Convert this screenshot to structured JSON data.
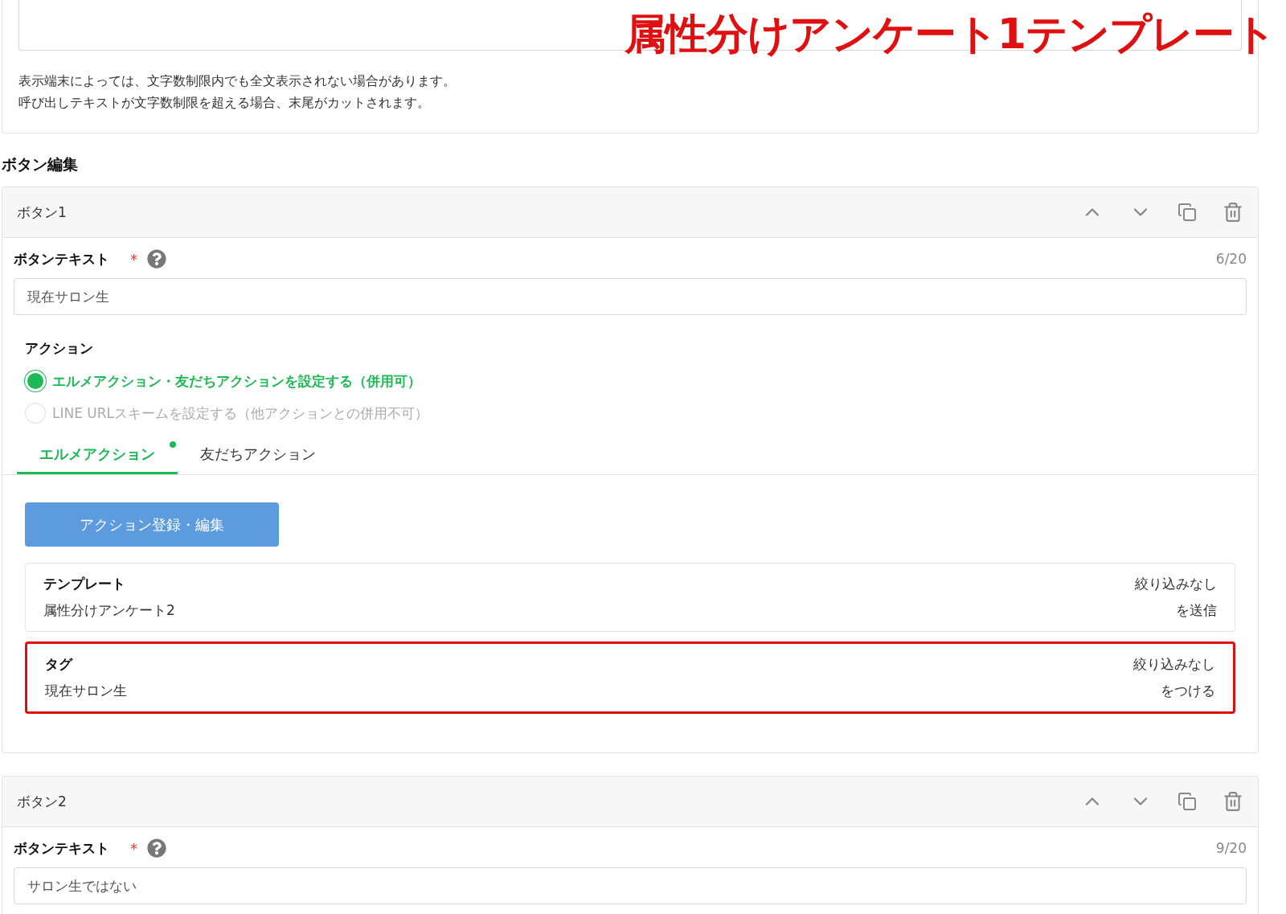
{
  "annotation": {
    "text": "属性分けアンケート1テンプレート"
  },
  "notes": [
    "表示端末によっては、文字数制限内でも全文表示されない場合があります。",
    "呼び出しテキストが文字数制限を超える場合、末尾がカットされます。"
  ],
  "section_title": "ボタン編集",
  "buttons": [
    {
      "title": "ボタン1",
      "text_label": "ボタンテキスト",
      "required_mark": "*",
      "counter": "6/20",
      "text_value": "現在サロン生",
      "action_label": "アクション",
      "action_options": [
        {
          "label": "エルメアクション・友だちアクションを設定する（併用可）",
          "selected": true,
          "disabled": false
        },
        {
          "label": "LINE URLスキームを設定する（他アクションとの併用不可）",
          "selected": false,
          "disabled": true
        }
      ],
      "tabs": [
        {
          "label": "エルメアクション",
          "selected": true,
          "dot": true
        },
        {
          "label": "友だちアクション",
          "selected": false,
          "dot": false
        }
      ],
      "edit_button": "アクション登録・編集",
      "actions": [
        {
          "type": "テンプレート",
          "value": "属性分けアンケート2",
          "filter": "絞り込みなし",
          "verb": "を送信",
          "highlighted": false
        },
        {
          "type": "タグ",
          "value": "現在サロン生",
          "filter": "絞り込みなし",
          "verb": "をつける",
          "highlighted": true
        }
      ]
    },
    {
      "title": "ボタン2",
      "text_label": "ボタンテキスト",
      "required_mark": "*",
      "counter": "9/20",
      "text_value": "サロン生ではない"
    }
  ]
}
